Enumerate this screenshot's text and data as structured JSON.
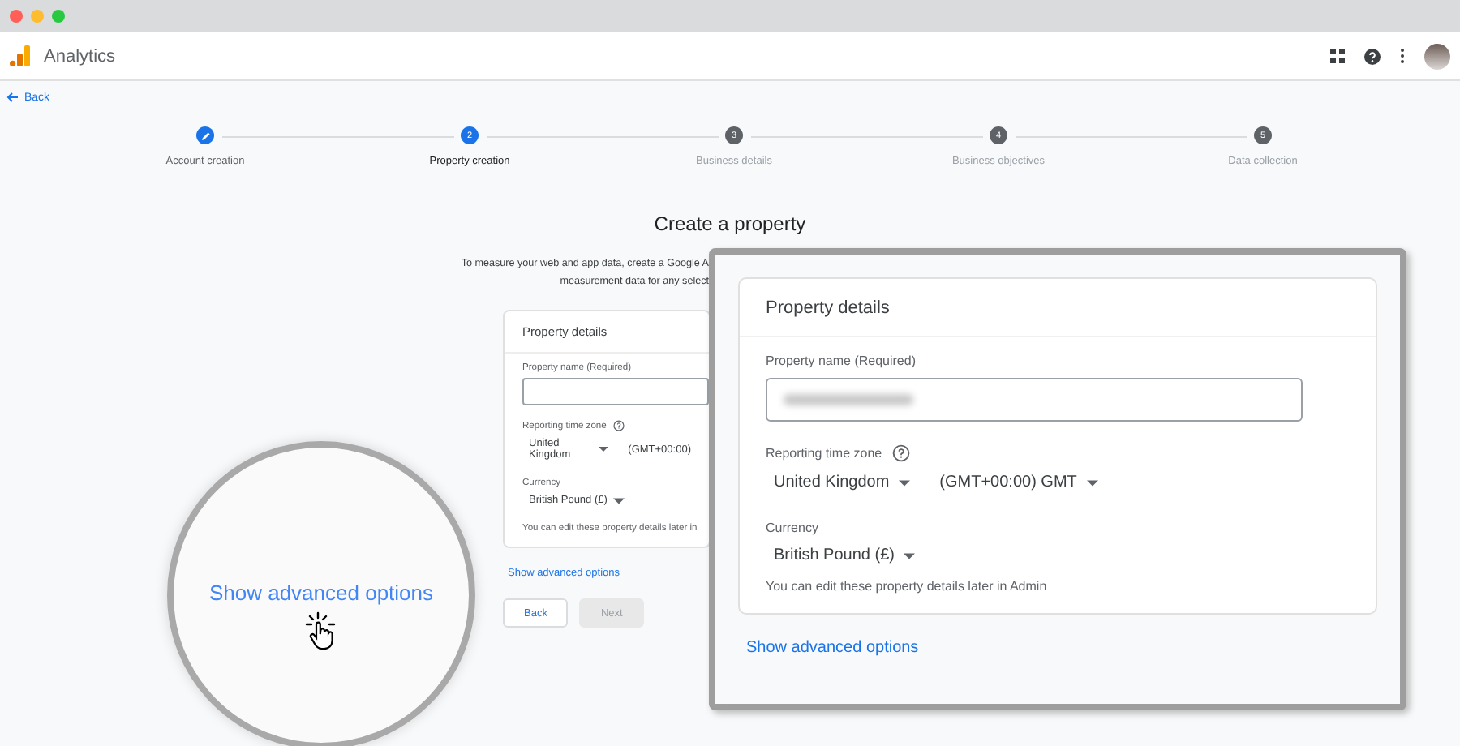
{
  "app": {
    "title": "Analytics"
  },
  "back_link": "Back",
  "steps": [
    {
      "kind": "done",
      "label": "Account creation"
    },
    {
      "kind": "current",
      "number": "2",
      "label": "Property creation"
    },
    {
      "kind": "upcoming",
      "number": "3",
      "label": "Business details"
    },
    {
      "kind": "upcoming",
      "number": "4",
      "label": "Business objectives"
    },
    {
      "kind": "upcoming",
      "number": "5",
      "label": "Data collection"
    }
  ],
  "page": {
    "title": "Create a property",
    "intro_lines": [
      "To measure your web and app data, create a Google A",
      "measurement data for any select"
    ]
  },
  "form": {
    "card_title": "Property details",
    "name_label": "Property name (Required)",
    "timezone_label": "Reporting time zone",
    "country": "United Kingdom",
    "timezone": "(GMT+00:00)",
    "currency_label": "Currency",
    "currency": "British Pound (£)",
    "note": "You can edit these property details later in",
    "advanced_link": "Show advanced options",
    "buttons": [
      {
        "label": "Back",
        "disabled": false
      },
      {
        "label": "Next",
        "disabled": true
      }
    ]
  },
  "magnifier": {
    "link": "Show advanced options"
  },
  "zoom_panel": {
    "card_title": "Property details",
    "name_label": "Property name (Required)",
    "timezone_label": "Reporting time zone",
    "country": "United Kingdom",
    "timezone": "(GMT+00:00) GMT",
    "currency_label": "Currency",
    "currency": "British Pound (£)",
    "note": "You can edit these property details later in Admin",
    "advanced_link": "Show advanced options"
  }
}
